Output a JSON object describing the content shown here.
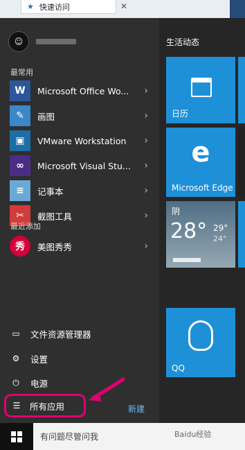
{
  "top_window": {
    "title": "快速访问",
    "close": "✕"
  },
  "user": {
    "avatar_glyph": "☺"
  },
  "sections": {
    "most_used": "最常用",
    "recently_added": "最近添加"
  },
  "apps": [
    {
      "label": "Microsoft Office Wo...",
      "icon": "word-icon",
      "color": "#2b579a",
      "glyph": "W"
    },
    {
      "label": "画图",
      "icon": "paint-icon",
      "color": "#3a87c9",
      "glyph": "✎"
    },
    {
      "label": "VMware Workstation",
      "icon": "vmware-icon",
      "color": "#1c6ea4",
      "glyph": "▣"
    },
    {
      "label": "Microsoft Visual Stu...",
      "icon": "visual-studio-icon",
      "color": "#4a2e86",
      "glyph": "∞"
    },
    {
      "label": "记事本",
      "icon": "notepad-icon",
      "color": "#6aa9d6",
      "glyph": "≡"
    },
    {
      "label": "截图工具",
      "icon": "snipping-tool-icon",
      "color": "#d23b3b",
      "glyph": "✂"
    }
  ],
  "recent": {
    "label": "美图秀秀",
    "icon": "meitu-icon",
    "color": "#d4003a",
    "glyph": "秀"
  },
  "bottom": {
    "file_explorer": "文件资源管理器",
    "settings": "设置",
    "power": "电源",
    "all_apps": "所有应用",
    "new": "新建"
  },
  "tiles": {
    "group_title": "生活动态",
    "calendar": "日历",
    "edge": "Microsoft Edge",
    "weather_condition": "阴",
    "weather_temp": "28°",
    "weather_high": "29°",
    "weather_low": "24°",
    "qq": "QQ"
  },
  "taskbar": {
    "search_placeholder": "有问题尽管问我",
    "watermark": "Baidu经验"
  }
}
